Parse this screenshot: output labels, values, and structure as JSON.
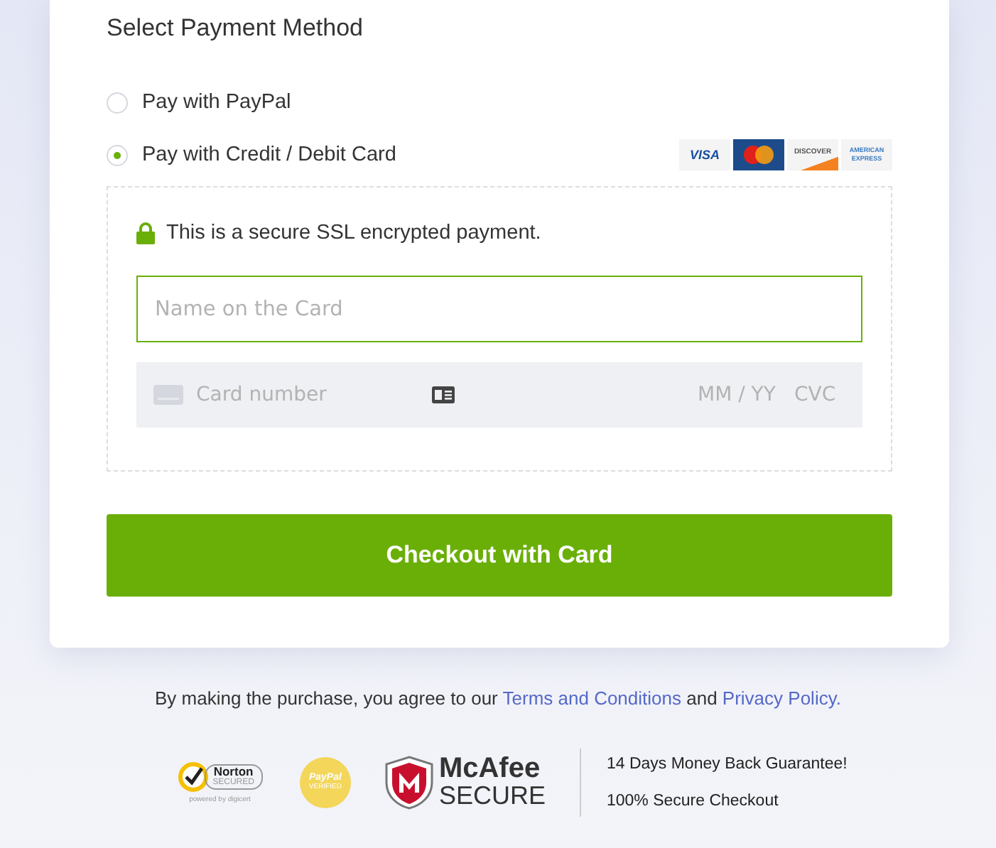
{
  "payment": {
    "title": "Select Payment Method",
    "methods": [
      {
        "label": "Pay with PayPal",
        "selected": false
      },
      {
        "label": "Pay with Credit / Debit Card",
        "selected": true
      }
    ],
    "card_logos": [
      {
        "kind": "visa",
        "text": "VISA"
      },
      {
        "kind": "mastercard"
      },
      {
        "kind": "discover",
        "text": "DISCOVER"
      },
      {
        "kind": "amex",
        "text": "AMERICAN EXPRESS"
      }
    ],
    "secure_note": "This is a secure SSL encrypted payment.",
    "name_field": {
      "placeholder": "Name on the Card"
    },
    "card_field": {
      "number_placeholder": "Card number",
      "expiry_placeholder": "MM / YY",
      "cvc_placeholder": "CVC"
    },
    "checkout_button": "Checkout with Card"
  },
  "agreement": {
    "text": "By making the purchase, you agree to our",
    "terms_link": "Terms and Conditions",
    "joiner": "and",
    "privacy_link": "Privacy Policy."
  },
  "trust": {
    "badges": [
      {
        "kind": "norton",
        "name": "Norton",
        "sub": "SECURED",
        "footer": "powered by digicert"
      },
      {
        "kind": "paypal",
        "name": "PayPal",
        "sub": "VERIFIED"
      },
      {
        "kind": "mcafee",
        "name": "McAfee",
        "sub": "SECURE"
      }
    ],
    "guarantees": [
      "14 Days Money Back Guarantee!",
      "100% Secure Checkout"
    ]
  }
}
